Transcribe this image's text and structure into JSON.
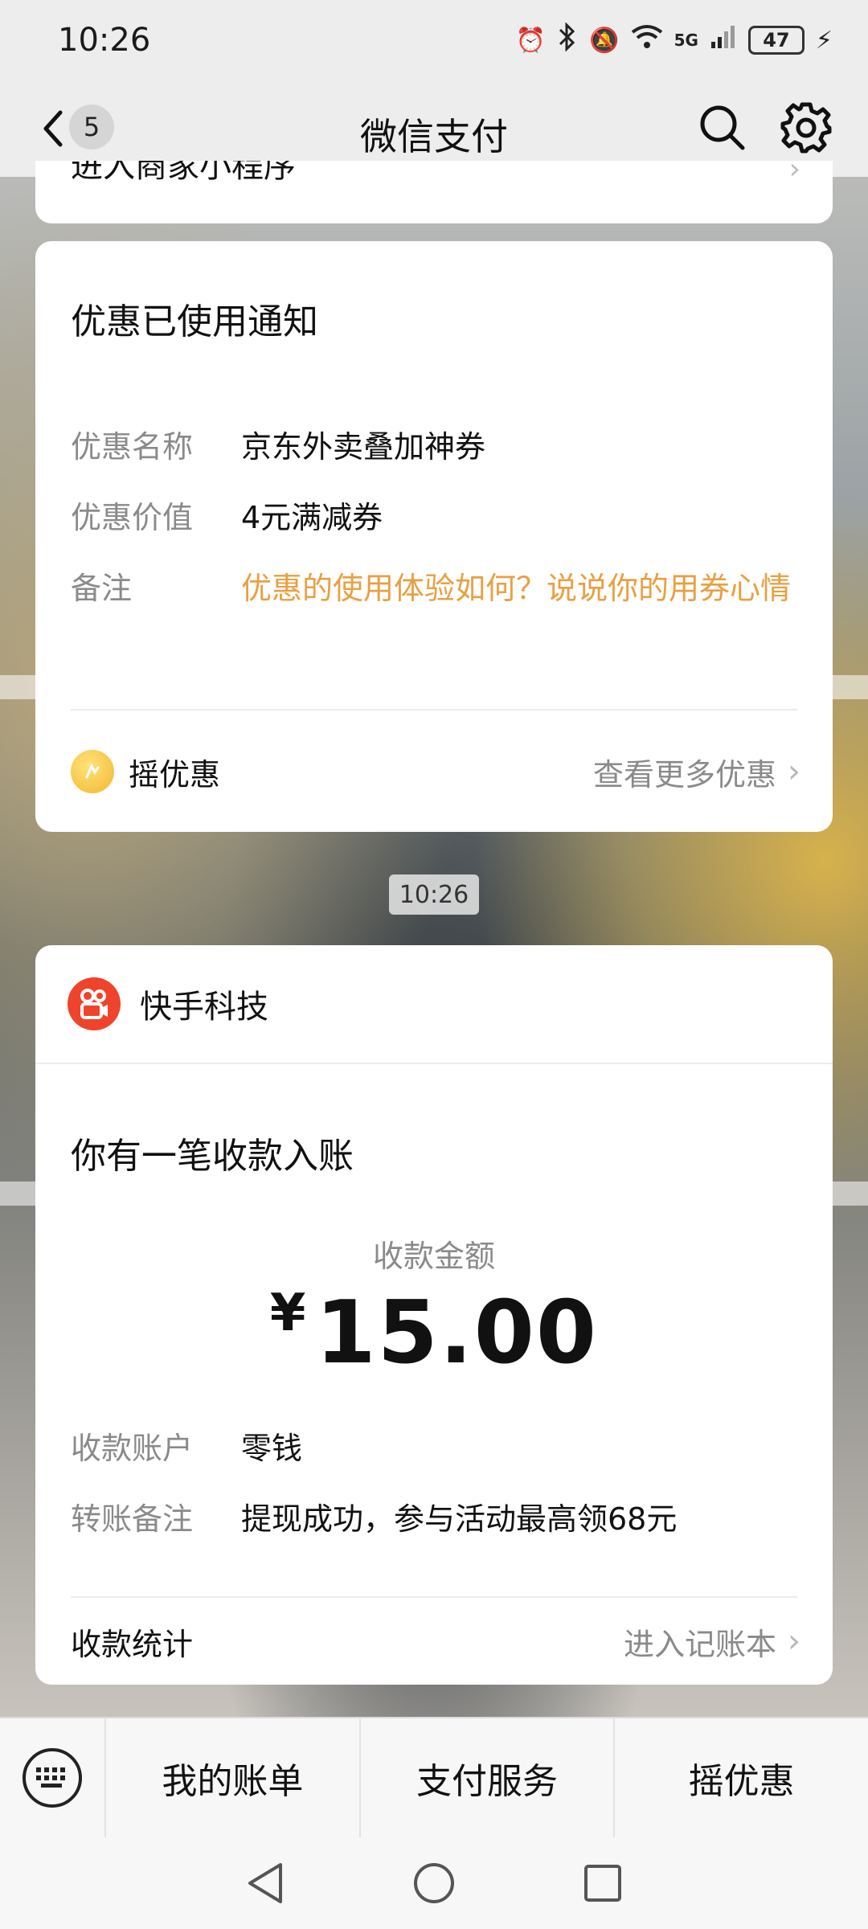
{
  "status_bar": {
    "time": "10:26",
    "network": "5G",
    "battery": "47"
  },
  "nav": {
    "back_count": "5",
    "title": "微信支付"
  },
  "partial_card": {
    "text": "进入商家小程序"
  },
  "coupon_card": {
    "title": "优惠已使用通知",
    "rows": [
      {
        "label": "优惠名称",
        "value": "京东外卖叠加神券"
      },
      {
        "label": "优惠价值",
        "value": "4元满减券"
      },
      {
        "label": "备注",
        "value": "优惠的使用体验如何？说说你的用券心情"
      }
    ],
    "footer_left": "摇优惠",
    "footer_right": "查看更多优惠"
  },
  "message_time": "10:26",
  "receipt_card": {
    "merchant": "快手科技",
    "title": "你有一笔收款入账",
    "amount_label": "收款金额",
    "currency": "¥",
    "amount": "15.00",
    "rows": [
      {
        "label": "收款账户",
        "value": "零钱"
      },
      {
        "label": "转账备注",
        "value": "提现成功，参与活动最高领68元"
      }
    ],
    "footer_left": "收款统计",
    "footer_right": "进入记账本"
  },
  "bottom_menu": {
    "items": [
      "我的账单",
      "支付服务",
      "摇优惠"
    ]
  },
  "colors": {
    "accent_orange": "#e8a043",
    "kuaishou_red": "#f0432b",
    "coupon_yellow": "#f2b730"
  }
}
